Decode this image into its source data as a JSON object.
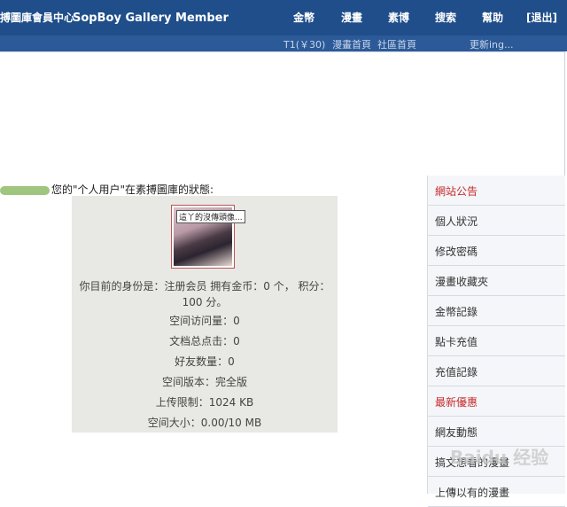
{
  "header": {
    "site_title": "搏圖庫會員中心",
    "brand": "SopBoy Gallery Member",
    "nav": [
      "金幣",
      "漫畫",
      "素博",
      "搜索",
      "幫助",
      "[退出]"
    ]
  },
  "subbar": {
    "items": [
      "T1(￥30)",
      "漫畫首頁",
      "社區首頁",
      "更新ing..."
    ]
  },
  "status": {
    "text": "您的\"个人用户\"在素搏圖庫的狀態:"
  },
  "profile": {
    "avatar_tag": "這丫的沒傳頭像...",
    "identity": "你目前的身份是：注册会员 拥有金币：0 个， 积分：",
    "points": "100 分。",
    "visits": "空间访问量：0",
    "doc_clicks": "文档总点击：0",
    "friends": "好友数量：0",
    "version": "空间版本：完全版",
    "upload_limit": "上传限制：1024 KB",
    "space_size": "空间大小：0.00/10 MB"
  },
  "sidebar": {
    "items": [
      {
        "label": "網站公告",
        "red": true
      },
      {
        "label": "個人狀況",
        "red": false
      },
      {
        "label": "修改密碼",
        "red": false
      },
      {
        "label": "漫畫收藏夾",
        "red": false
      },
      {
        "label": "金幣記錄",
        "red": false
      },
      {
        "label": "點卡充值",
        "red": false
      },
      {
        "label": "充值記錄",
        "red": false
      },
      {
        "label": "最新優惠",
        "red": true
      },
      {
        "label": "網友動態",
        "red": false
      },
      {
        "label": "搞文想看的漫畫",
        "red": false
      },
      {
        "label": "上傳以有的漫畫",
        "red": false
      }
    ]
  },
  "watermark": "Baidu 经验"
}
